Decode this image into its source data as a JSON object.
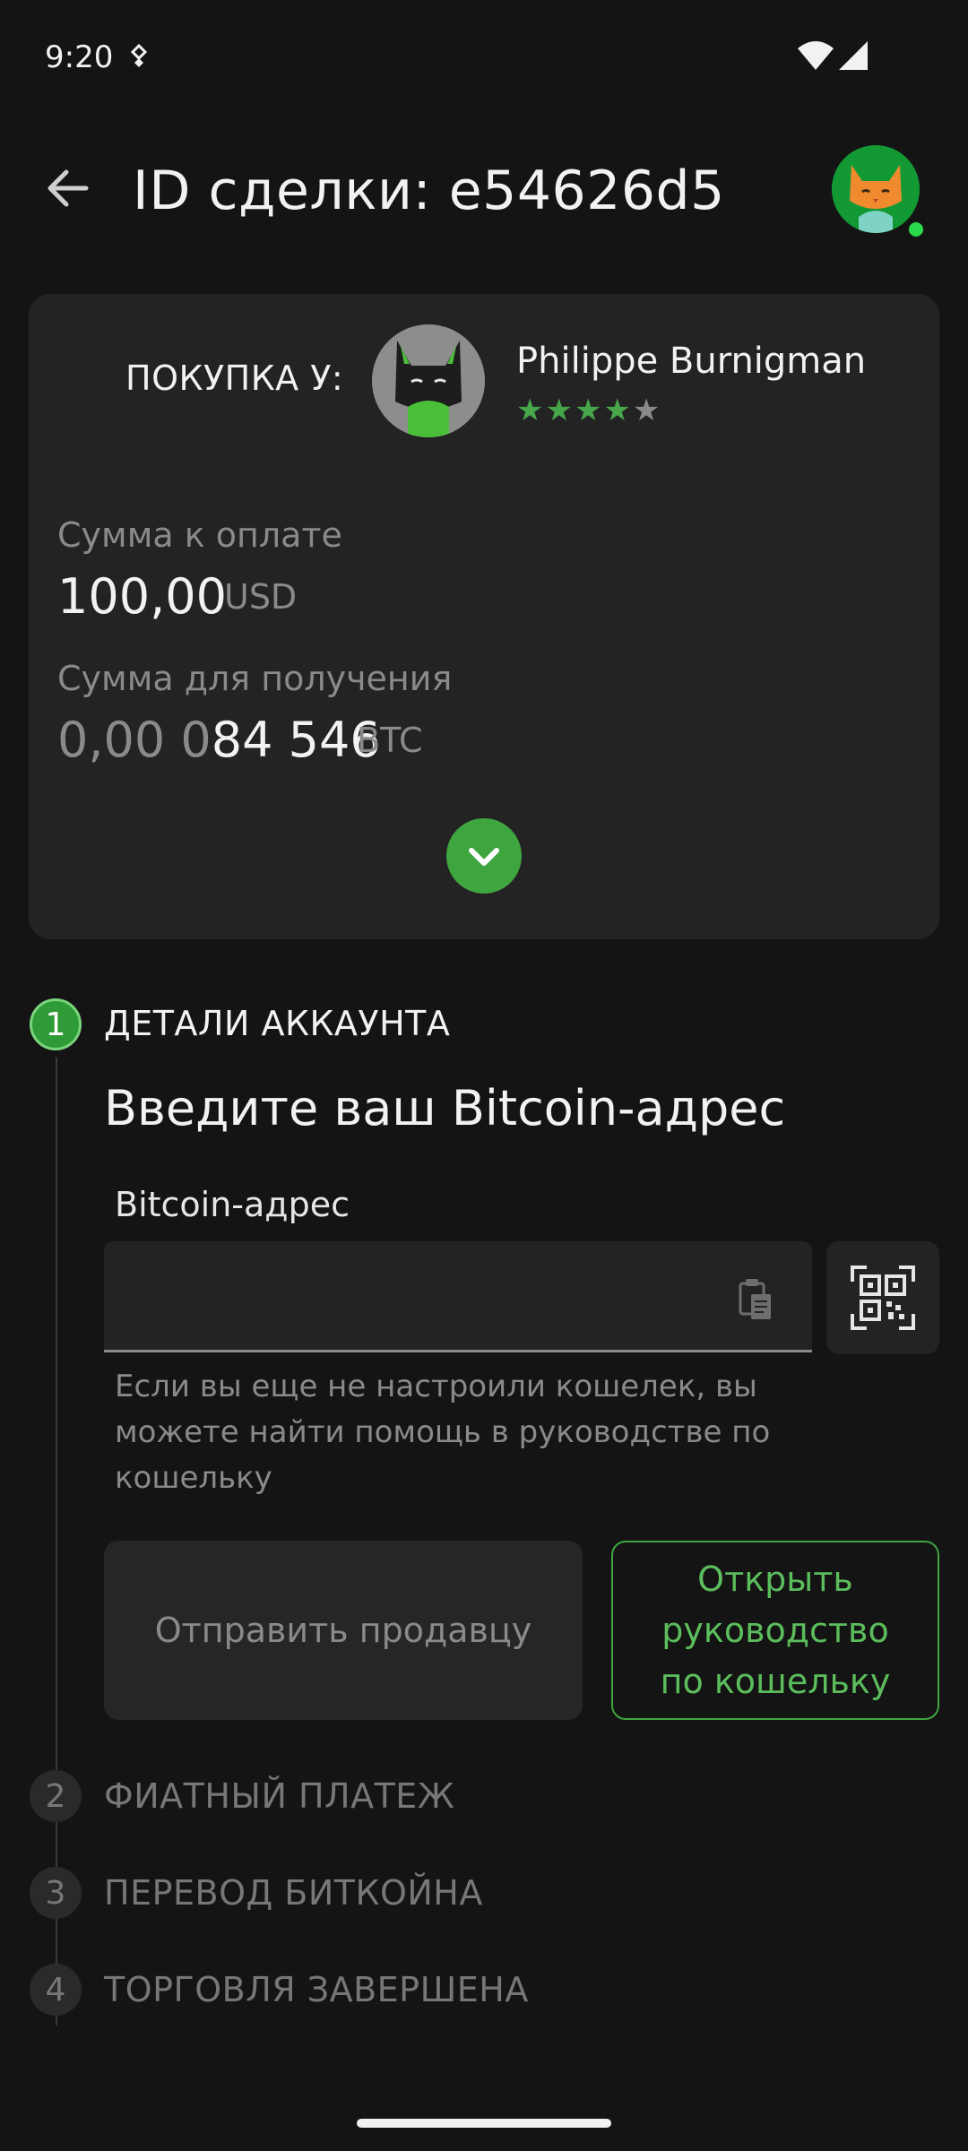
{
  "status_bar": {
    "time": "9:20"
  },
  "header": {
    "title": "ID сделки: e54626d5"
  },
  "summary": {
    "buy_from_label": "ПОКУПКА У:",
    "seller_name": "Philippe Burnigman",
    "rating": 4.5,
    "stars_full": "★★★★",
    "stars_half": "★",
    "pay_label": "Сумма к оплате",
    "pay_value": "100,00",
    "pay_currency": "USD",
    "receive_label": "Сумма для получения",
    "receive_value_dim": "0,00 0",
    "receive_value_bright": "84 546",
    "receive_currency": "BTC"
  },
  "steps": [
    {
      "number": "1",
      "title": "ДЕТАЛИ АККАУНТА",
      "active": true
    },
    {
      "number": "2",
      "title": "ФИАТНЫЙ ПЛАТЕЖ",
      "active": false
    },
    {
      "number": "3",
      "title": "ПЕРЕВОД БИТКОЙНА",
      "active": false
    },
    {
      "number": "4",
      "title": "ТОРГОВЛЯ ЗАВЕРШЕНА",
      "active": false
    }
  ],
  "account_step": {
    "heading": "Введите ваш Bitcoin-адрес",
    "field_label": "Bitcoin-адрес",
    "field_value": "",
    "helper_text": "Если вы еще не настроили кошелек, вы можете найти помощь в руководстве по кошельку",
    "send_button": "Отправить продавцу",
    "guide_button": "Открыть руководство по кошельку"
  },
  "colors": {
    "accent": "#3ea53f",
    "background": "#141414",
    "card": "#232323"
  },
  "icons": [
    "back-arrow-icon",
    "paste-icon",
    "qr-scan-icon",
    "chevron-down-icon",
    "wifi-icon",
    "signal-icon"
  ]
}
